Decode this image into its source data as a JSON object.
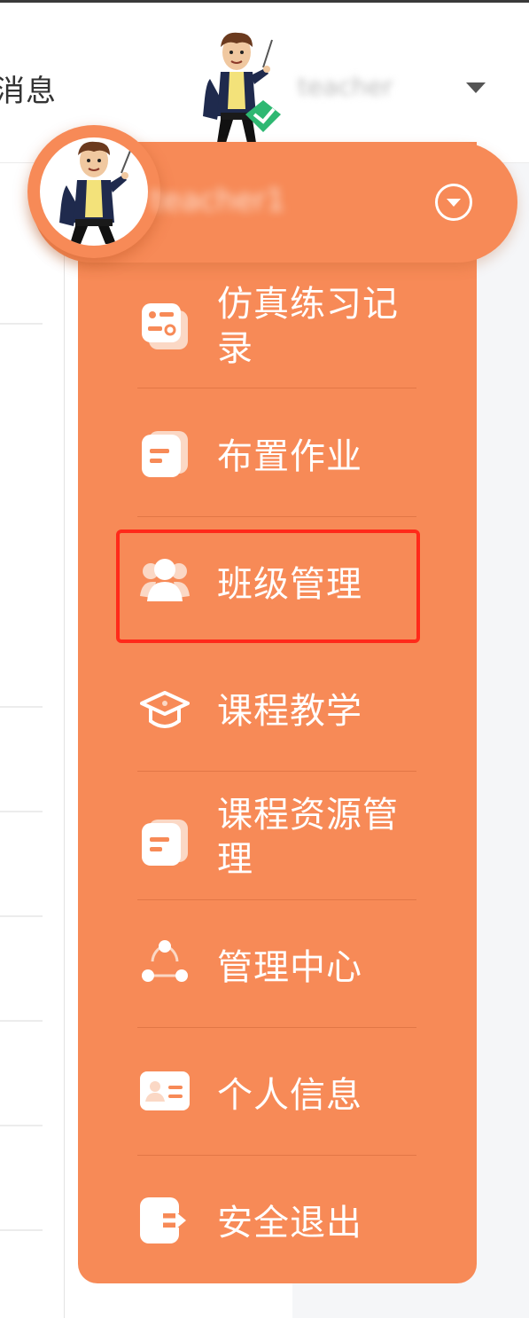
{
  "header": {
    "messages_label": "消息",
    "username": "teacher",
    "dropdown_caret_icon": "caret-down-icon",
    "avatar_badge_icon": "verified-check-icon"
  },
  "dropdown": {
    "user_name": "teacher1",
    "toggle_icon": "chevron-circle-down-icon",
    "items": [
      {
        "label": "仿真练习记录",
        "icon": "record-icon"
      },
      {
        "label": "布置作业",
        "icon": "document-icon"
      },
      {
        "label": "班级管理",
        "icon": "group-icon",
        "highlighted": true
      },
      {
        "label": "课程教学",
        "icon": "graduation-cap-icon"
      },
      {
        "label": "课程资源管理",
        "icon": "document-icon"
      },
      {
        "label": "管理中心",
        "icon": "network-icon"
      },
      {
        "label": "个人信息",
        "icon": "id-card-icon"
      },
      {
        "label": "安全退出",
        "icon": "logout-icon"
      }
    ]
  },
  "colors": {
    "menu_background": "#f78a57",
    "highlight_border": "#ff2a1a",
    "menu_text": "#ffffff"
  }
}
